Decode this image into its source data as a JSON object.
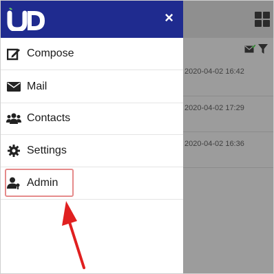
{
  "drawer": {
    "logo_name": "ud-logo",
    "close_icon": "×",
    "items": [
      {
        "label": "Compose",
        "icon": "compose-icon"
      },
      {
        "label": "Mail",
        "icon": "envelope-icon"
      },
      {
        "label": "Contacts",
        "icon": "users-icon"
      },
      {
        "label": "Settings",
        "icon": "gear-icon"
      },
      {
        "label": "Admin",
        "icon": "admin-user-icon"
      }
    ]
  },
  "mail_list": {
    "timestamps": [
      "2020-04-02 16:42",
      "2020-04-02 17:29",
      "2020-04-02 16:36"
    ]
  },
  "colors": {
    "header_bg": "#1f2b8f",
    "overlay": "#9c9c9c",
    "highlight_border": "#e58a8a",
    "arrow": "#e02020"
  }
}
